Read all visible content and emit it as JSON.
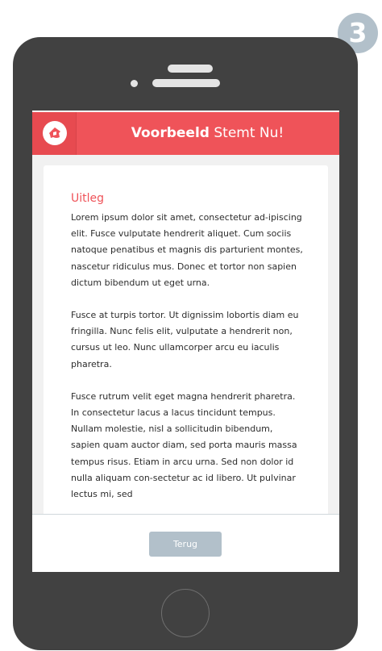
{
  "step_badge": {
    "number": "3"
  },
  "header": {
    "title_bold": "Voorbeeld",
    "title_rest": " Stemt Nu!",
    "logo_icon": "house-flag-icon"
  },
  "content": {
    "section_title": "Uitleg",
    "paragraphs": [
      "Lorem ipsum dolor sit amet, consectetur ad-ipiscing elit. Fusce vulputate hendrerit aliquet. Cum sociis natoque penatibus et magnis dis parturient montes, nascetur ridiculus mus. Donec et tortor non sapien dictum bibendum ut eget urna.",
      "Fusce at turpis tortor. Ut dignissim lobortis diam eu fringilla. Nunc felis elit, vulputate a hendrerit non, cursus ut leo. Nunc ullamcorper arcu eu iaculis pharetra.",
      "Fusce rutrum velit eget magna hendrerit pharetra. In consectetur lacus a lacus tincidunt tempus. Nullam molestie, nisl a sollicitudin bibendum, sapien quam auctor diam, sed porta mauris massa tempus risus. Etiam in arcu urna. Sed non dolor id nulla aliquam con-sectetur ac id libero. Ut pulvinar lectus mi, sed"
    ]
  },
  "footer": {
    "back_label": "Terug"
  },
  "colors": {
    "accent": "#ef5359",
    "button": "#b2c0ca",
    "phone_body": "#414141",
    "screen_bg": "#f1f1f1"
  }
}
